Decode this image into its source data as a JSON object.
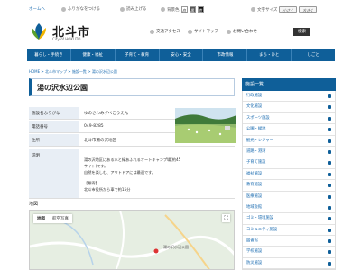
{
  "util": {
    "top_link": "ホームへ",
    "furigana": "ふりがなをつける",
    "read_aloud": "読み上げる",
    "color_label": "背景色",
    "color_buttons": [
      "白",
      "黒",
      "青"
    ],
    "fontsize_label": "文字サイズ",
    "fontsize_small": "小さく",
    "fontsize_large": "大きく"
  },
  "header": {
    "city_name": "北斗市",
    "city_en": "City of HOKUTO",
    "access": "交通アクセス",
    "sitemap": "サイトマップ",
    "contact": "お問い合わせ",
    "search_button": "検索"
  },
  "nav": [
    "暮らし・手続き",
    "健康・福祉",
    "子育て・教育",
    "安心・安全",
    "市政情報",
    "まち・ひと",
    "しごと"
  ],
  "breadcrumb": "HOME > 北斗市マップ > 施設一覧 > 湯の沢水辺公園",
  "page": {
    "title": "湯の沢水辺公園",
    "rows": [
      {
        "label": "施設名ふりがな",
        "value": "ゆのさわみずべこうえん"
      },
      {
        "label": "電話番号",
        "value": "049-8285"
      },
      {
        "label": "住所",
        "value": "北斗市湯の沢地区"
      },
      {
        "label": "説明",
        "value": ""
      }
    ],
    "description": [
      "湯の沢地区にある水と緑あふれるオートキャンプ場(約45サイト)です。",
      "自然を楽しむ、アウトドアには最適です。",
      "",
      "【最寄】",
      "北斗市役所から車で約15分"
    ]
  },
  "map": {
    "heading": "地図",
    "tab_map": "地図",
    "tab_satellite": "航空写真",
    "place_label": "湯の沢水辺公園"
  },
  "sidebar": {
    "title": "施設一覧",
    "items": [
      "行政施設",
      "文化施設",
      "スポーツ施設",
      "公園・緑地",
      "観光・レジャー",
      "道路・港湾",
      "子育て施設",
      "福祉施設",
      "教育施設",
      "医療施設",
      "地域会館",
      "ゴミ・環境施設",
      "コミュニティ施設",
      "図書館",
      "学校施設",
      "防災施設"
    ]
  }
}
